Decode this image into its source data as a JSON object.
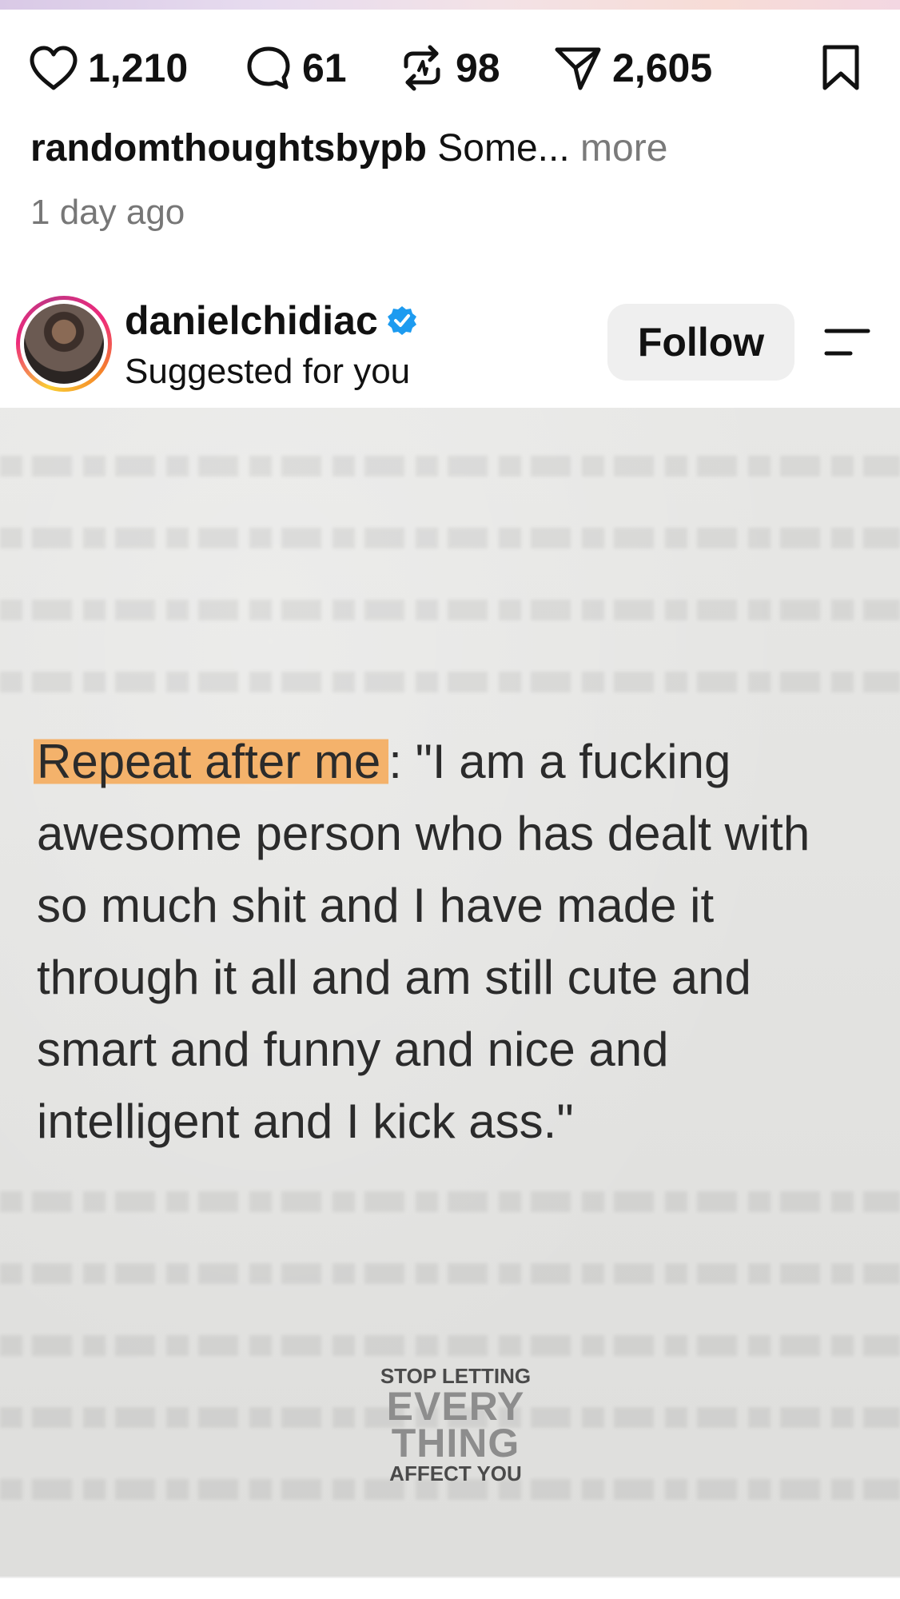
{
  "stats": {
    "likes": "1,210",
    "comments": "61",
    "reposts": "98",
    "shares": "2,605"
  },
  "caption": {
    "username": "randomthoughtsbypb",
    "text": "Some...",
    "more": "more",
    "time": "1 day ago"
  },
  "post": {
    "username": "danielchidiac",
    "subtitle": "Suggested for you",
    "follow_label": "Follow",
    "verified": true
  },
  "image": {
    "highlight": "Repeat after me",
    "quote_after": ": \"I am a fucking awesome person who has dealt with so much shit and I have made it through it all and am still cute and smart and funny and nice and intelligent and I kick ass.\"",
    "logo": {
      "line1": "STOP LETTING",
      "line2": "EVERY",
      "line3": "THING",
      "line4": "AFFECT YOU"
    }
  },
  "colors": {
    "highlight": "#f4b26b",
    "verified": "#1d9bf0",
    "follow_bg": "#efefef"
  },
  "icons": [
    "heart-icon",
    "comment-icon",
    "repost-icon",
    "share-icon",
    "bookmark-icon",
    "verified-badge-icon",
    "menu-icon"
  ]
}
